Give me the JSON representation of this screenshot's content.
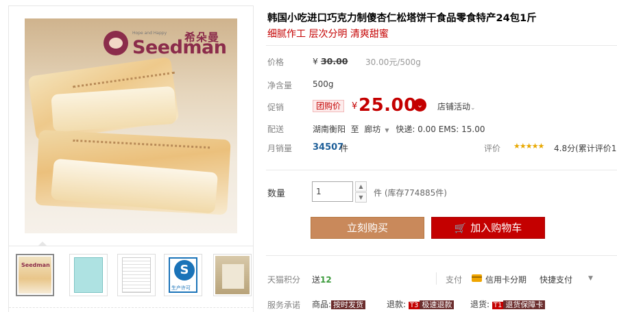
{
  "brand": {
    "name_cn": "希朵曼",
    "tagline": "Hope and Happy",
    "name_en": "Seedman"
  },
  "thumbnails": [
    {
      "name": "thumb-product",
      "label": "Seedman"
    },
    {
      "name": "thumb-certificate",
      "label": ""
    },
    {
      "name": "thumb-document",
      "label": ""
    },
    {
      "name": "thumb-qs-license",
      "label": "生产许可"
    },
    {
      "name": "thumb-package",
      "label": ""
    }
  ],
  "product": {
    "title": "韩国小吃进口巧克力制傻杏仁松塔饼干食品零食特产24包1斤",
    "subtitle": "细腻作工 层次分明 清爽甜蜜"
  },
  "price": {
    "label": "价格",
    "currency": "¥",
    "original": "30.00",
    "unit_price": "30.00元/500g"
  },
  "net_weight": {
    "label": "净含量",
    "value": "500g"
  },
  "promo": {
    "label": "促销",
    "badge": "团购价",
    "currency": "¥",
    "price": "25.00",
    "chevron": "⌄",
    "store_activity": "店铺活动",
    "store_chevron": "⌄"
  },
  "shipping": {
    "label": "配送",
    "from": "湖南衡阳",
    "to_word": "至",
    "destination": "廊坊",
    "arrow": "▼",
    "express": "快递: 0.00 EMS: 15.00"
  },
  "monthly_sales": {
    "label": "月销量",
    "count": "34507",
    "unit": "件"
  },
  "rating": {
    "label": "评价",
    "stars": "★★★★★",
    "score_text": "4.8分(累计评价1"
  },
  "quantity": {
    "label": "数量",
    "value": "1",
    "up": "▲",
    "down": "▼",
    "stock": "件 (库存774885件)"
  },
  "buttons": {
    "buy_now": "立刻购买",
    "cart_icon": "🛒",
    "add_to_cart": "加入购物车"
  },
  "points": {
    "label": "天猫积分",
    "prefix": "送",
    "value": "12"
  },
  "payment": {
    "label": "支付",
    "card": "信用卡分期",
    "quick": "快捷支付",
    "chevron": "▼"
  },
  "service": {
    "label": "服务承诺",
    "items": [
      {
        "prefix": "商品:",
        "code": "",
        "tag": "按时发货"
      },
      {
        "prefix": "退款:",
        "code": "T3",
        "tag": "极速退款"
      },
      {
        "prefix": "退货:",
        "code": "T1",
        "tag": "退货保障卡"
      }
    ]
  }
}
